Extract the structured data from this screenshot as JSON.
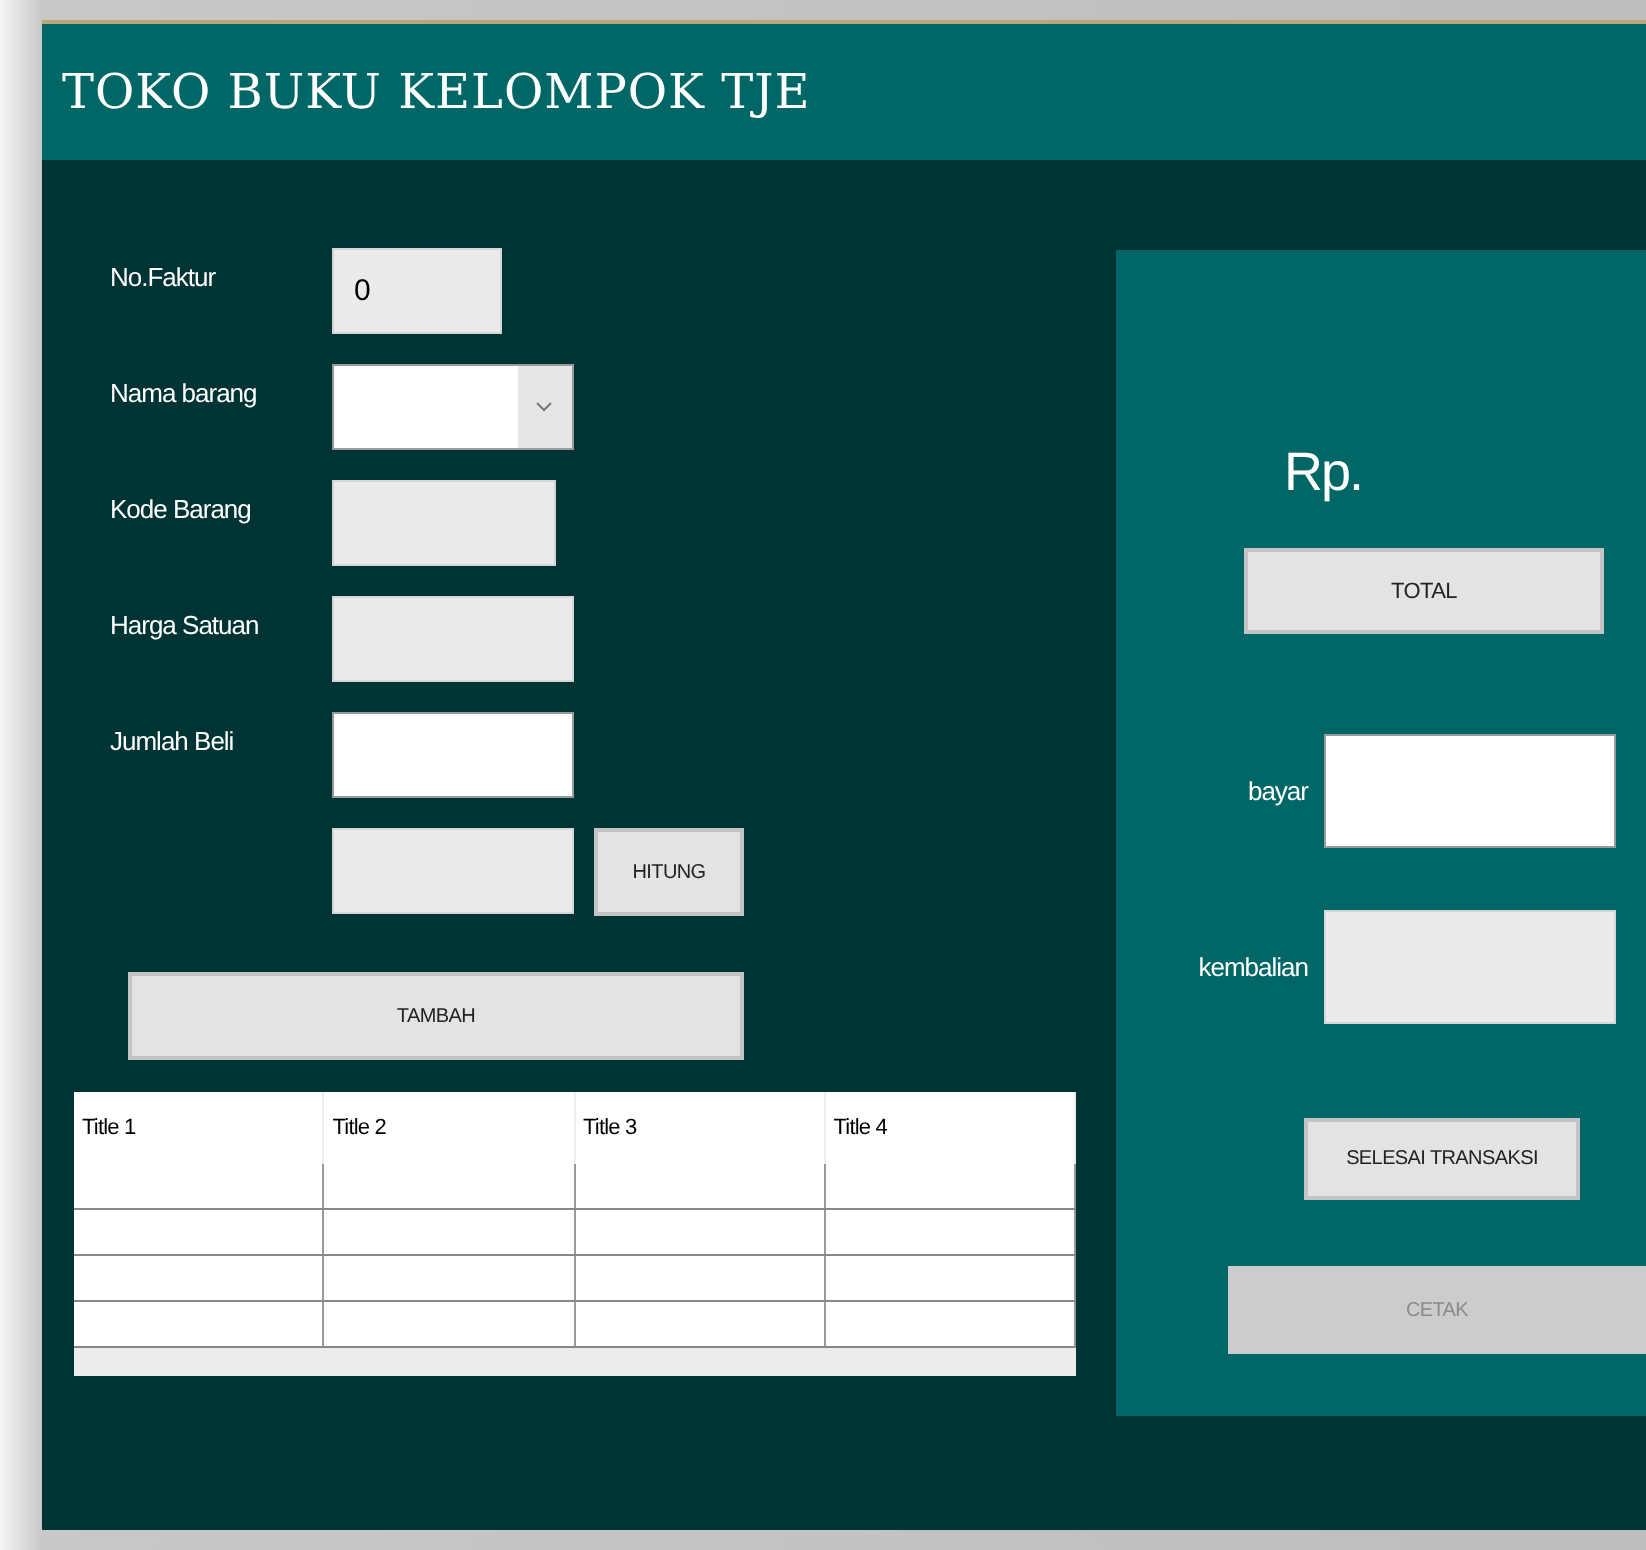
{
  "window": {
    "title": "TOKO BUKU KELOMPOK TJE"
  },
  "form": {
    "fields": [
      {
        "label": "No.Faktur",
        "kind": "text",
        "value": "0",
        "editable": false
      },
      {
        "label": "Nama barang",
        "kind": "combo",
        "editable": true
      },
      {
        "label": "Kode Barang",
        "kind": "text",
        "editable": false
      },
      {
        "label": "Harga Satuan",
        "kind": "text",
        "editable": false
      },
      {
        "label": "Jumlah Beli",
        "kind": "text",
        "editable": true
      },
      {
        "kind": "text",
        "editable": false,
        "button": "HITUNG"
      }
    ],
    "add_button": "TAMBAH"
  },
  "table": {
    "columns": [
      "Title 1",
      "Title 2",
      "Title 3",
      "Title 4"
    ],
    "rows": [
      {},
      {},
      {},
      {}
    ]
  },
  "payment": {
    "currency": "Rp.",
    "total_button": "TOTAL",
    "fields": [
      {
        "label": "bayar",
        "editable": true
      },
      {
        "label": "kembalian",
        "editable": false
      }
    ],
    "buttons": [
      {
        "label": "SELESAI TRANSAKSI",
        "disabled": false,
        "kind": "small"
      },
      {
        "label": "CETAK",
        "disabled": true,
        "kind": "wide"
      }
    ]
  }
}
